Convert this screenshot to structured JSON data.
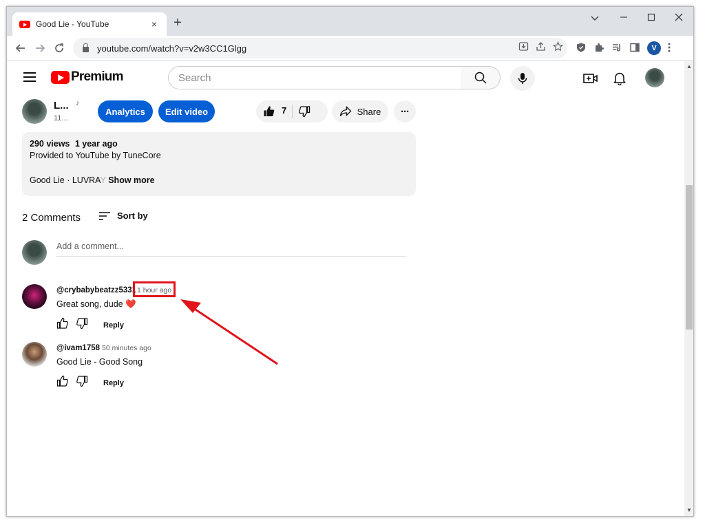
{
  "browser": {
    "tab_title": "Good Lie - YouTube",
    "tab_close": "×",
    "new_tab": "+",
    "url": "youtube.com/watch?v=v2w3CC1Glgg",
    "profile_initial": "V"
  },
  "masthead": {
    "brand": "Premium",
    "search_placeholder": "Search"
  },
  "video": {
    "channel_name": "L...",
    "channel_note": "♪",
    "channel_subs": "11...",
    "analytics_label": "Analytics",
    "edit_label": "Edit video",
    "like_count": "7",
    "share_label": "Share",
    "more_label": "···"
  },
  "description": {
    "views": "290 views",
    "age": "1 year ago",
    "provider": "Provided to YouTube by TuneCore",
    "snippet": "Good Lie · LUVRA",
    "snippet_fade": "Y",
    "show_more": "Show more"
  },
  "comments": {
    "count_label": "2 Comments",
    "sort_label": "Sort by",
    "add_placeholder": "Add a comment...",
    "items": [
      {
        "author": "@crybabybeatzz5331",
        "time": "1 hour ago",
        "text": "Great song, dude ❤️",
        "reply": "Reply"
      },
      {
        "author": "@ivam1758",
        "time": "50 minutes ago",
        "text": "Good Lie - Good Song",
        "reply": "Reply"
      }
    ]
  },
  "annotation": {
    "highlight_color": "#e1141b"
  }
}
